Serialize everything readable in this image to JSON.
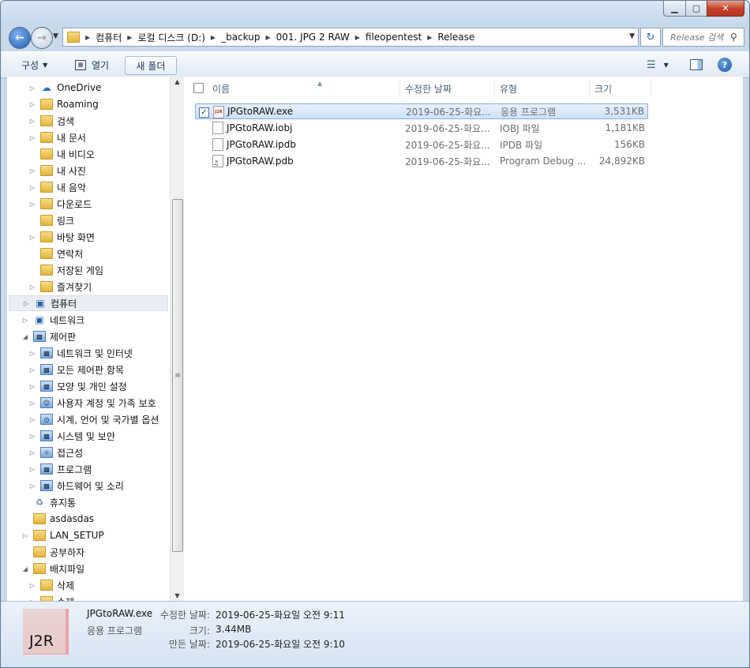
{
  "window": {
    "controls": {
      "minimize": "▁",
      "maximize": "▢",
      "close": "✕"
    }
  },
  "address": {
    "root_icon": "folder-icon",
    "segments": [
      "컴퓨터",
      "로컬 디스크 (D:)",
      "_backup",
      "001. JPG 2 RAW",
      "fileopentest",
      "Release"
    ]
  },
  "search": {
    "placeholder": "Release 검색"
  },
  "toolbar": {
    "organize": "구성",
    "open": "열기",
    "new_folder": "새 폴더"
  },
  "nav_tree": [
    {
      "label": "OneDrive",
      "icon": "cloud-icon",
      "level": 1,
      "expander": "▷"
    },
    {
      "label": "Roaming",
      "icon": "folder-icon",
      "level": 1,
      "expander": "▷"
    },
    {
      "label": "검색",
      "icon": "search-folder-icon",
      "level": 1,
      "expander": "▷"
    },
    {
      "label": "내 문서",
      "icon": "documents-icon",
      "level": 1,
      "expander": "▷"
    },
    {
      "label": "내 비디오",
      "icon": "videos-icon",
      "level": 1,
      "expander": ""
    },
    {
      "label": "내 사진",
      "icon": "pictures-icon",
      "level": 1,
      "expander": "▷"
    },
    {
      "label": "내 음악",
      "icon": "music-icon",
      "level": 1,
      "expander": "▷"
    },
    {
      "label": "다운로드",
      "icon": "downloads-icon",
      "level": 1,
      "expander": "▷"
    },
    {
      "label": "링크",
      "icon": "links-icon",
      "level": 1,
      "expander": ""
    },
    {
      "label": "바탕 화면",
      "icon": "desktop-icon",
      "level": 1,
      "expander": "▷"
    },
    {
      "label": "연락처",
      "icon": "contacts-icon",
      "level": 1,
      "expander": ""
    },
    {
      "label": "저장된 게임",
      "icon": "saved-games-icon",
      "level": 1,
      "expander": ""
    },
    {
      "label": "즐겨찾기",
      "icon": "favorites-icon",
      "level": 1,
      "expander": "▷"
    },
    {
      "label": "컴퓨터",
      "icon": "computer-icon",
      "level": 0,
      "expander": "▷",
      "selected": true
    },
    {
      "label": "네트워크",
      "icon": "network-icon",
      "level": 0,
      "expander": "▷"
    },
    {
      "label": "제어판",
      "icon": "control-panel-icon",
      "level": 0,
      "expander": "◢"
    },
    {
      "label": "네트워크 및 인터넷",
      "icon": "network-internet-icon",
      "level": 1,
      "expander": "▷"
    },
    {
      "label": "모든 제어판 항목",
      "icon": "control-panel-icon",
      "level": 1,
      "expander": "▷"
    },
    {
      "label": "모양 및 개인 설정",
      "icon": "appearance-icon",
      "level": 1,
      "expander": "▷"
    },
    {
      "label": "사용자 계정 및 가족 보호",
      "icon": "users-icon",
      "level": 1,
      "expander": "▷"
    },
    {
      "label": "시계, 언어 및 국가별 옵션",
      "icon": "clock-globe-icon",
      "level": 1,
      "expander": "▷"
    },
    {
      "label": "시스템 및 보안",
      "icon": "system-security-icon",
      "level": 1,
      "expander": "▷"
    },
    {
      "label": "접근성",
      "icon": "accessibility-icon",
      "level": 1,
      "expander": "▷"
    },
    {
      "label": "프로그램",
      "icon": "programs-icon",
      "level": 1,
      "expander": "▷"
    },
    {
      "label": "하드웨어 및 소리",
      "icon": "hardware-sound-icon",
      "level": 1,
      "expander": "▷"
    },
    {
      "label": "휴지통",
      "icon": "recycle-bin-icon",
      "level": 0,
      "expander": ""
    },
    {
      "label": "asdasdas",
      "icon": "folder-icon",
      "level": 0,
      "expander": ""
    },
    {
      "label": "LAN_SETUP",
      "icon": "folder-icon",
      "level": 0,
      "expander": "▷"
    },
    {
      "label": "공부하자",
      "icon": "folder-icon",
      "level": 0,
      "expander": ""
    },
    {
      "label": "배치파일",
      "icon": "folder-icon",
      "level": 0,
      "expander": "◢"
    },
    {
      "label": "삭제",
      "icon": "folder-icon",
      "level": 1,
      "expander": "▷"
    },
    {
      "label": "수제",
      "icon": "folder-icon",
      "level": 1,
      "expander": "▷"
    }
  ],
  "columns": {
    "name": "이름",
    "modified": "수정한 날짜",
    "type": "유형",
    "size": "크기"
  },
  "files": [
    {
      "name": "JPGtoRAW.exe",
      "modified": "2019-06-25-화요...",
      "type": "응용 프로그램",
      "size": "3,531KB",
      "icon": "exe-icon",
      "selected": true
    },
    {
      "name": "JPGtoRAW.iobj",
      "modified": "2019-06-25-화요...",
      "type": "IOBJ 파일",
      "size": "1,181KB",
      "icon": "file-icon",
      "selected": false
    },
    {
      "name": "JPGtoRAW.ipdb",
      "modified": "2019-06-25-화요...",
      "type": "IPDB 파일",
      "size": "156KB",
      "icon": "file-icon",
      "selected": false
    },
    {
      "name": "JPGtoRAW.pdb",
      "modified": "2019-06-25-화요...",
      "type": "Program Debug ...",
      "size": "24,892KB",
      "icon": "pdb-icon",
      "selected": false
    }
  ],
  "details": {
    "thumbnail_text": "J2R",
    "name": "JPGtoRAW.exe",
    "type": "응용 프로그램",
    "modified_label": "수정한 날짜:",
    "modified_value": "2019-06-25-화요일 오전 9:11",
    "size_label": "크기:",
    "size_value": "3.44MB",
    "created_label": "만든 날짜:",
    "created_value": "2019-06-25-화요일 오전 9:10"
  }
}
